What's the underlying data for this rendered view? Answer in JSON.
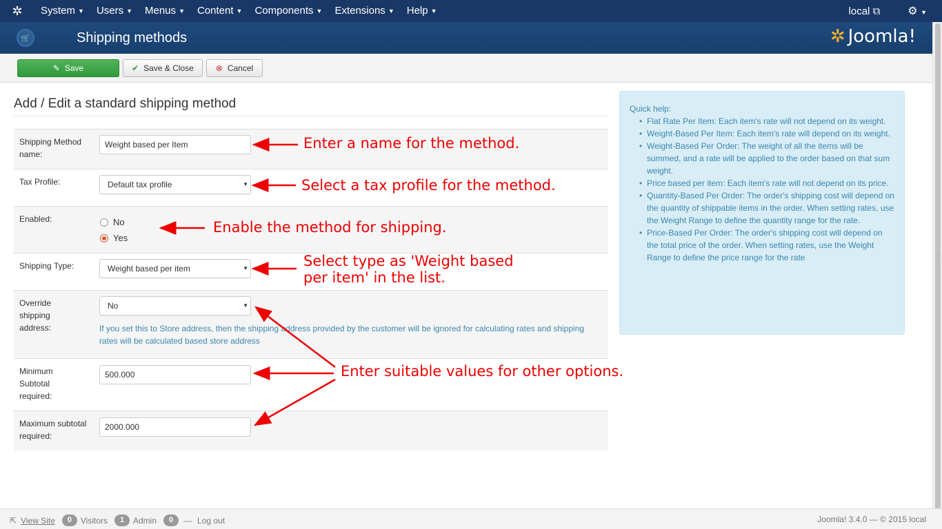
{
  "navbar": {
    "menu": [
      "System",
      "Users",
      "Menus",
      "Content",
      "Components",
      "Extensions",
      "Help"
    ],
    "site_label": "local"
  },
  "titlebar": {
    "title": "Shipping methods",
    "brand": "Joomla!"
  },
  "toolbar": {
    "save": "Save",
    "save_close": "Save & Close",
    "cancel": "Cancel"
  },
  "form": {
    "heading": "Add / Edit a standard shipping method",
    "name_label": "Shipping Method name:",
    "name_value": "Weight based per Item",
    "tax_label": "Tax Profile:",
    "tax_value": "Default tax profile",
    "enabled_label": "Enabled:",
    "enabled_no": "No",
    "enabled_yes": "Yes",
    "type_label": "Shipping Type:",
    "type_value": "Weight based per item",
    "override_label": "Override shipping address:",
    "override_value": "No",
    "override_help": "If you set this to Store address, then the shipping address provided by the customer will be ignored for calculating rates and shipping rates will be calculated based store address",
    "min_label": "Minimum Subtotal required:",
    "min_value": "500.000",
    "max_label": "Maximum subtotal required:",
    "max_value": "2000.000"
  },
  "annotations": {
    "name": "Enter a name for the method.",
    "tax": "Select a tax profile for the method.",
    "enable": "Enable the method for shipping.",
    "type_line1": "Select type as 'Weight based",
    "type_line2": "per item' in the list.",
    "others": "Enter suitable values for other options."
  },
  "quickhelp": {
    "title": "Quick help:",
    "items": [
      "Flat Rate Per Item: Each item's rate will not depend on its weight.",
      "Weight-Based Per Item: Each item's rate will depend on its weight.",
      "Weight-Based Per Order: The weight of all the items will be summed, and a rate will be applied to the order based on that sum weight.",
      "Price based per item: Each item's rate will not depend on its price.",
      "Quantity-Based Per Order: The order's shipping cost will depend on the quantity of shippable items in the order. When setting rates, use the Weight Range to define the quantity range for the rate.",
      "Price-Based Per Order: The order's shipping cost will depend on the total price of the order. When setting rates, use the Weight Range to define the price range for the rate"
    ]
  },
  "statusbar": {
    "view_site": "View Site",
    "visitors_count": "0",
    "visitors_label": "Visitors",
    "admin_count": "1",
    "admin_label": "Admin",
    "logout_count": "0",
    "logout_label": "Log out",
    "version": "Joomla! 3.4.0 — © 2015 local"
  },
  "colors": {
    "navbar": "#1a3867",
    "save_button": "#3ea948",
    "annotation": "#ee0000",
    "help_bg": "#d9edf7"
  }
}
